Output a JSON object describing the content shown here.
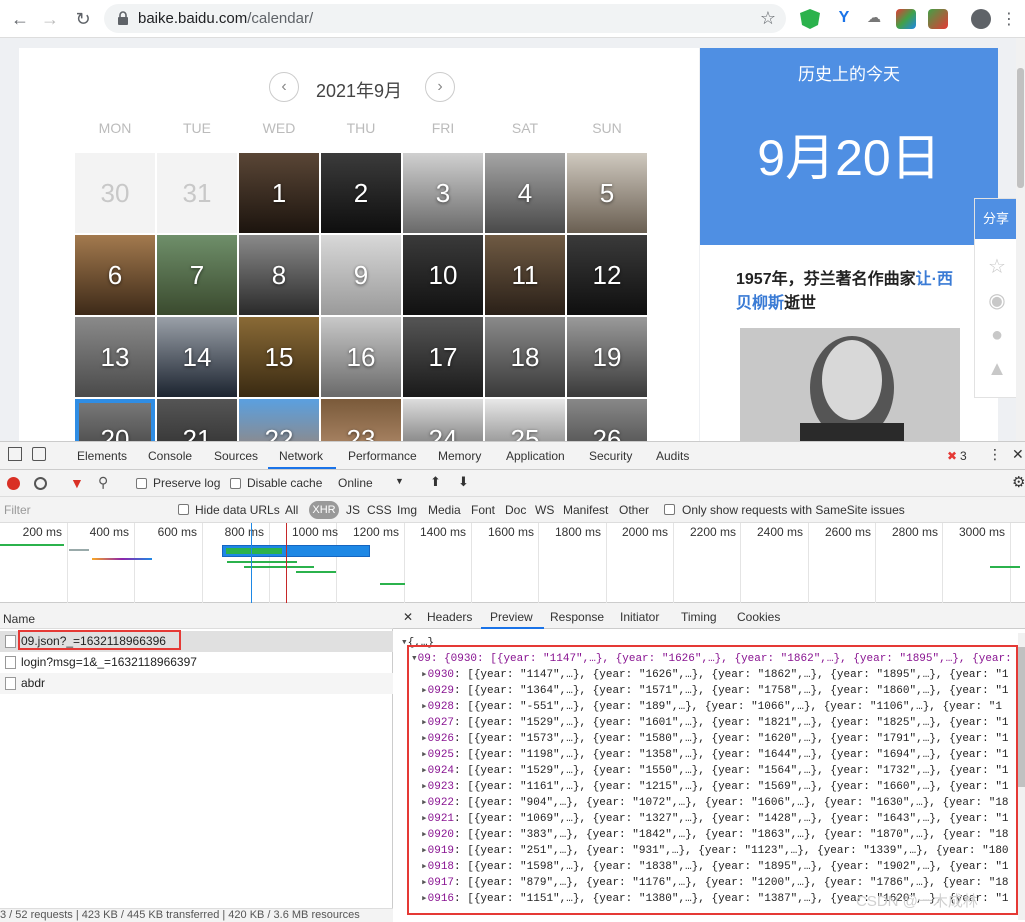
{
  "browser": {
    "url_host": "baike.baidu.com",
    "url_path": "/calendar/"
  },
  "calendar": {
    "month_title": "2021年9月",
    "weekdays": [
      "MON",
      "TUE",
      "WED",
      "THU",
      "FRI",
      "SAT",
      "SUN"
    ],
    "days": [
      "30",
      "31",
      "1",
      "2",
      "3",
      "4",
      "5",
      "6",
      "7",
      "8",
      "9",
      "10",
      "11",
      "12",
      "13",
      "14",
      "15",
      "16",
      "17",
      "18",
      "19",
      "20",
      "21",
      "22",
      "23",
      "24",
      "25",
      "26"
    ]
  },
  "history": {
    "title": "历史上的今天",
    "date": "9月20日",
    "event_prefix": "1957年，芬兰著名作曲家",
    "event_person": "让·西贝柳斯",
    "event_suffix": "逝世",
    "share_label": "分享"
  },
  "devtools": {
    "tabs": [
      "Elements",
      "Console",
      "Sources",
      "Network",
      "Performance",
      "Memory",
      "Application",
      "Security",
      "Audits"
    ],
    "active_tab": "Network",
    "error_count": "3",
    "toolbar": {
      "preserve_log": "Preserve log",
      "disable_cache": "Disable cache",
      "throttle": "Online"
    },
    "filter": {
      "placeholder": "Filter",
      "hide_data_urls": "Hide data URLs",
      "types": [
        "All",
        "XHR",
        "JS",
        "CSS",
        "Img",
        "Media",
        "Font",
        "Doc",
        "WS",
        "Manifest",
        "Other"
      ],
      "active_type": "XHR",
      "samesite": "Only show requests with SameSite issues"
    },
    "timeline_ticks": [
      "200 ms",
      "400 ms",
      "600 ms",
      "800 ms",
      "1000 ms",
      "1200 ms",
      "1400 ms",
      "1600 ms",
      "1800 ms",
      "2000 ms",
      "2200 ms",
      "2400 ms",
      "2600 ms",
      "2800 ms",
      "3000 ms"
    ],
    "requests_header": "Name",
    "requests": [
      "09.json?_=1632118966396",
      "login?msg=1&_=1632118966397",
      "abdr"
    ],
    "status": "3 / 52 requests | 423 KB / 445 KB transferred | 420 KB / 3.6 MB resources",
    "preview_tabs": [
      "Headers",
      "Preview",
      "Response",
      "Initiator",
      "Timing",
      "Cookies"
    ],
    "active_preview_tab": "Preview",
    "json_root": "{,…}",
    "json_top": "09: {0930: [{year: \"1147\",…}, {year: \"1626\",…}, {year: \"1862\",…}, {year: \"1895\",…}, {year: \"1",
    "json_rows": [
      {
        "key": "0930",
        "value": "[{year: \"1147\",…}, {year: \"1626\",…}, {year: \"1862\",…}, {year: \"1895\",…}, {year: \"1"
      },
      {
        "key": "0929",
        "value": "[{year: \"1364\",…}, {year: \"1571\",…}, {year: \"1758\",…}, {year: \"1860\",…}, {year: \"1"
      },
      {
        "key": "0928",
        "value": "[{year: \"-551\",…}, {year: \"189\",…}, {year: \"1066\",…}, {year: \"1106\",…}, {year: \"1"
      },
      {
        "key": "0927",
        "value": "[{year: \"1529\",…}, {year: \"1601\",…}, {year: \"1821\",…}, {year: \"1825\",…}, {year: \"1"
      },
      {
        "key": "0926",
        "value": "[{year: \"1573\",…}, {year: \"1580\",…}, {year: \"1620\",…}, {year: \"1791\",…}, {year: \"1"
      },
      {
        "key": "0925",
        "value": "[{year: \"1198\",…}, {year: \"1358\",…}, {year: \"1644\",…}, {year: \"1694\",…}, {year: \"1"
      },
      {
        "key": "0924",
        "value": "[{year: \"1529\",…}, {year: \"1550\",…}, {year: \"1564\",…}, {year: \"1732\",…}, {year: \"1"
      },
      {
        "key": "0923",
        "value": "[{year: \"1161\",…}, {year: \"1215\",…}, {year: \"1569\",…}, {year: \"1660\",…}, {year: \"1"
      },
      {
        "key": "0922",
        "value": "[{year: \"904\",…}, {year: \"1072\",…}, {year: \"1606\",…}, {year: \"1630\",…}, {year: \"18"
      },
      {
        "key": "0921",
        "value": "[{year: \"1069\",…}, {year: \"1327\",…}, {year: \"1428\",…}, {year: \"1643\",…}, {year: \"1"
      },
      {
        "key": "0920",
        "value": "[{year: \"383\",…}, {year: \"1842\",…}, {year: \"1863\",…}, {year: \"1870\",…}, {year: \"18"
      },
      {
        "key": "0919",
        "value": "[{year: \"251\",…}, {year: \"931\",…}, {year: \"1123\",…}, {year: \"1339\",…}, {year: \"180"
      },
      {
        "key": "0918",
        "value": "[{year: \"1598\",…}, {year: \"1838\",…}, {year: \"1895\",…}, {year: \"1902\",…}, {year: \"1"
      },
      {
        "key": "0917",
        "value": "[{year: \"879\",…}, {year: \"1176\",…}, {year: \"1200\",…}, {year: \"1786\",…}, {year: \"18"
      },
      {
        "key": "0916",
        "value": "[{year: \"1151\",…}, {year: \"1380\",…}, {year: \"1387\",…}, {year: \"1620\",…}, {year: \"1"
      }
    ],
    "watermark": "CSDN @一木成林"
  },
  "colors": {
    "accent": "#4f8fe3",
    "highlight_border": "#e53935",
    "active_tab_underline": "#1a73e8"
  }
}
